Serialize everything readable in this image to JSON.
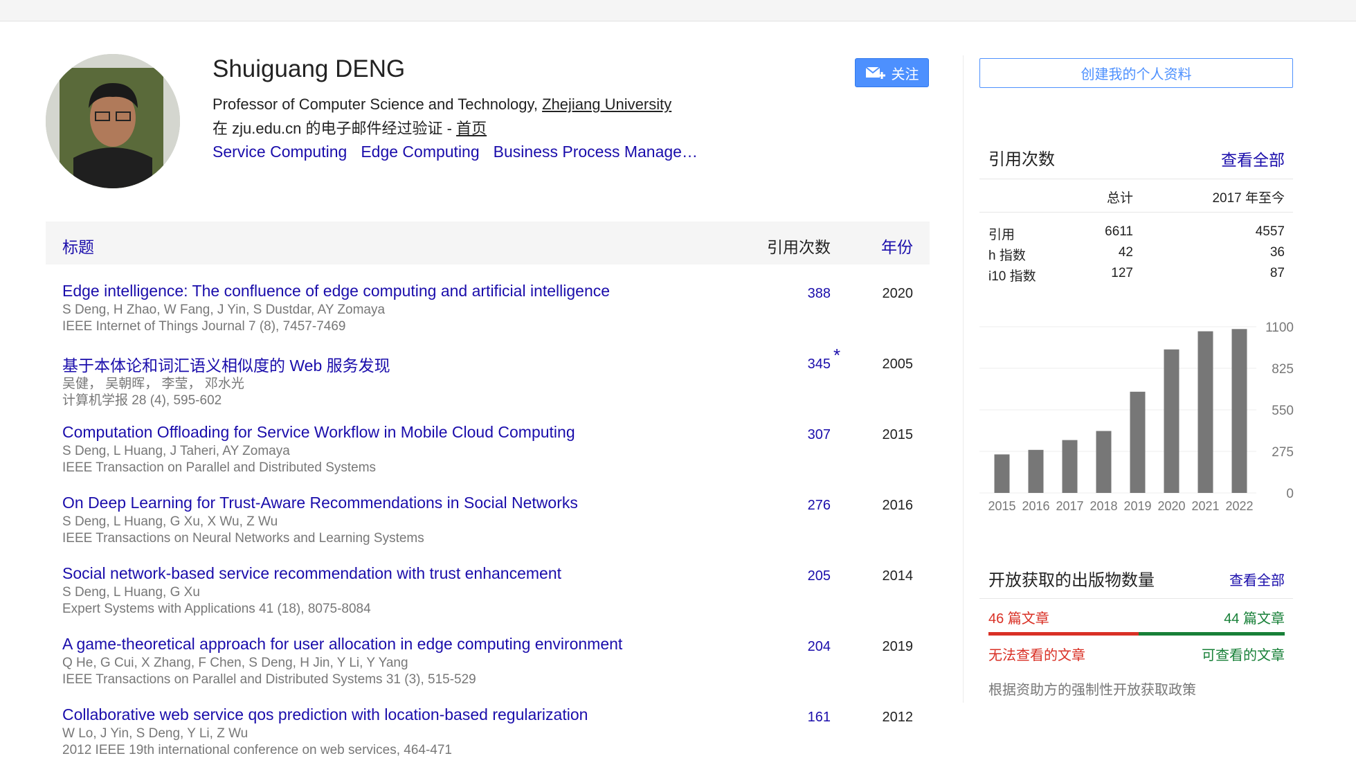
{
  "profile": {
    "name": "Shuiguang DENG",
    "affiliation_prefix": "Professor of Computer Science and Technology, ",
    "affiliation_link": "Zhejiang University",
    "verified_text": "在 zju.edu.cn 的电子邮件经过验证 - ",
    "homepage_label": "首页",
    "interests": [
      "Service Computing",
      "Edge Computing",
      "Business Process Manage…"
    ],
    "follow_label": "关注"
  },
  "table": {
    "header_title": "标题",
    "header_cites": "引用次数",
    "header_year": "年份",
    "rows": [
      {
        "title": "Edge intelligence: The confluence of edge computing and artificial intelligence",
        "authors": "S Deng, H Zhao, W Fang, J Yin, S Dustdar, AY Zomaya",
        "venue": "IEEE Internet of Things Journal 7 (8), 7457-7469",
        "cites": "388",
        "star": "",
        "year": "2020"
      },
      {
        "title": "基于本体论和词汇语义相似度的 Web 服务发现",
        "authors": "吴健， 吴朝晖， 李莹， 邓水光",
        "venue": "计算机学报 28 (4), 595-602",
        "cites": "345",
        "star": "*",
        "year": "2005"
      },
      {
        "title": "Computation Offloading for Service Workflow in Mobile Cloud Computing",
        "authors": "S Deng, L Huang, J Taheri, AY Zomaya",
        "venue": "IEEE Transaction on Parallel and Distributed Systems",
        "cites": "307",
        "star": "",
        "year": "2015"
      },
      {
        "title": "On Deep Learning for Trust-Aware Recommendations in Social Networks",
        "authors": "S Deng, L Huang, G Xu, X Wu, Z Wu",
        "venue": "IEEE Transactions on Neural Networks and Learning Systems",
        "cites": "276",
        "star": "",
        "year": "2016"
      },
      {
        "title": "Social network-based service recommendation with trust enhancement",
        "authors": "S Deng, L Huang, G Xu",
        "venue": "Expert Systems with Applications 41 (18), 8075-8084",
        "cites": "205",
        "star": "",
        "year": "2014"
      },
      {
        "title": "A game-theoretical approach for user allocation in edge computing environment",
        "authors": "Q He, G Cui, X Zhang, F Chen, S Deng, H Jin, Y Li, Y Yang",
        "venue": "IEEE Transactions on Parallel and Distributed Systems 31 (3), 515-529",
        "cites": "204",
        "star": "",
        "year": "2019"
      },
      {
        "title": "Collaborative web service qos prediction with location-based regularization",
        "authors": "W Lo, J Yin, S Deng, Y Li, Z Wu",
        "venue": "2012 IEEE 19th international conference on web services, 464-471",
        "cites": "161",
        "star": "",
        "year": "2012"
      }
    ]
  },
  "sidebar": {
    "create_profile_label": "创建我的个人资料",
    "citations": {
      "heading": "引用次数",
      "view_all": "查看全部",
      "col_total": "总计",
      "col_since": "2017 年至今",
      "rows": [
        {
          "label": "引用",
          "total": "6611",
          "since": "4557"
        },
        {
          "label": "h 指数",
          "total": "42",
          "since": "36"
        },
        {
          "label": "i10 指数",
          "total": "127",
          "since": "87"
        }
      ]
    },
    "open_access": {
      "heading": "开放获取的出版物数量",
      "view_all": "查看全部",
      "unavailable_count": "46 篇文章",
      "available_count": "44 篇文章",
      "unavailable_label": "无法查看的文章",
      "available_label": "可查看的文章",
      "policy_text": "根据资助方的强制性开放获取政策"
    }
  },
  "chart_data": {
    "type": "bar",
    "categories": [
      "2015",
      "2016",
      "2017",
      "2018",
      "2019",
      "2020",
      "2021",
      "2022"
    ],
    "values": [
      255,
      285,
      350,
      410,
      670,
      950,
      1070,
      1085
    ],
    "y_ticks": [
      "1100",
      "825",
      "550",
      "275",
      "0"
    ],
    "ylim": [
      0,
      1100
    ],
    "bar_color": "#777777",
    "grid": true
  },
  "colors": {
    "link": "#1a0dab",
    "follow_button": "#4d90fe",
    "oa_red": "#d93025",
    "oa_green": "#188038"
  }
}
